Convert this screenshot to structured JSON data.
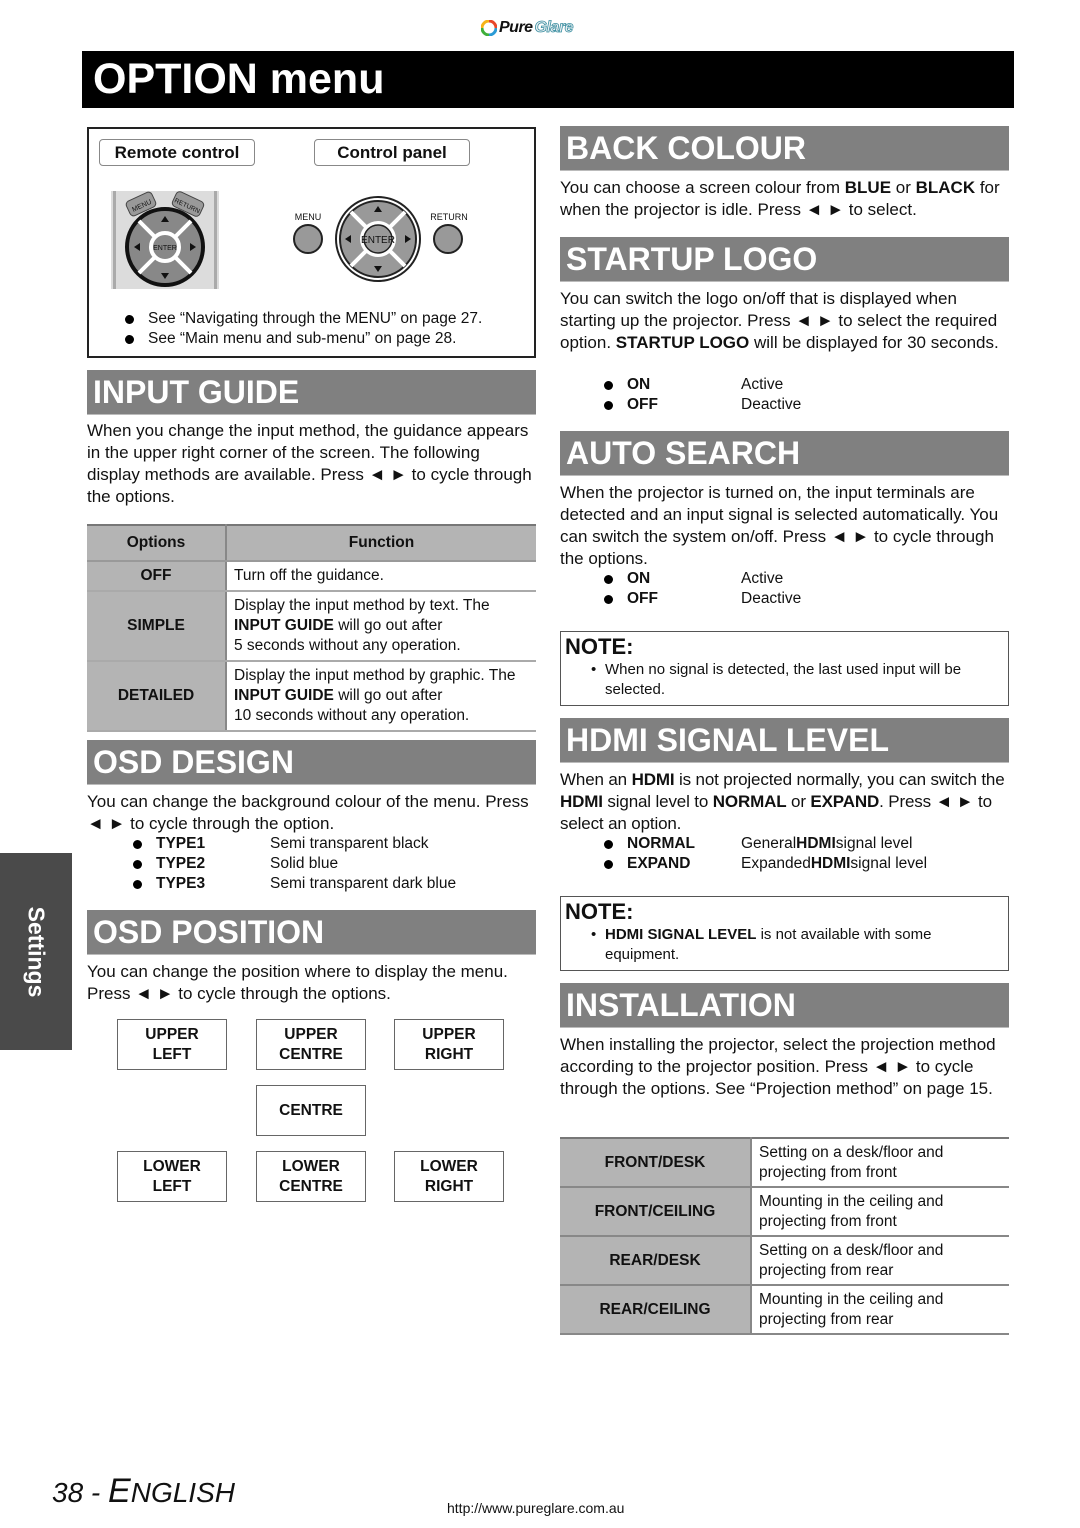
{
  "header": {
    "logo_part1": "Pure",
    "logo_part2": "Glare",
    "title": "OPTION menu"
  },
  "side_tab": {
    "label": "Settings"
  },
  "nav_box": {
    "remote_label": "Remote control",
    "panel_label": "Control panel",
    "remote_buttons": {
      "menu": "MENU",
      "return": "RETURN",
      "enter": "ENTER"
    },
    "panel_buttons": {
      "menu": "MENU",
      "return": "RETURN",
      "enter": "ENTER"
    },
    "bullets": [
      "See “Navigating through the MENU” on page 27.",
      "See “Main menu and sub-menu” on page 28."
    ]
  },
  "input_guide": {
    "heading": "INPUT GUIDE",
    "text": "When you change the input method, the guidance appears in the upper right corner of the screen. The following display methods are available. Press ◄ ► to cycle through the options.",
    "table": {
      "headers": [
        "Options",
        "Function"
      ],
      "rows": [
        {
          "option": "OFF",
          "line1": "Turn off the guidance.",
          "bold": "",
          "line2": "",
          "line3": ""
        },
        {
          "option": "SIMPLE",
          "line1": "Display the input method by text. The",
          "bold": "INPUT GUIDE",
          "line2": " will go out after",
          "line3": "5 seconds without any operation."
        },
        {
          "option": "DETAILED",
          "line1": "Display the input method by graphic. The",
          "bold": "INPUT GUIDE",
          "line2": " will go out after",
          "line3": "10 seconds without any operation."
        }
      ]
    }
  },
  "osd_design": {
    "heading": "OSD DESIGN",
    "text": "You can change the background colour of the menu. Press ◄ ► to cycle through the option.",
    "options": [
      {
        "key": "TYPE1",
        "value": "Semi transparent black"
      },
      {
        "key": "TYPE2",
        "value": "Solid blue"
      },
      {
        "key": "TYPE3",
        "value": "Semi transparent dark blue"
      }
    ]
  },
  "osd_position": {
    "heading": "OSD POSITION",
    "text": "You can change the position where to display the menu. Press ◄ ► to cycle through the options.",
    "positions": {
      "upper_left": [
        "UPPER",
        "LEFT"
      ],
      "upper_centre": [
        "UPPER",
        "CENTRE"
      ],
      "upper_right": [
        "UPPER",
        "RIGHT"
      ],
      "centre": [
        "CENTRE"
      ],
      "lower_left": [
        "LOWER",
        "LEFT"
      ],
      "lower_centre": [
        "LOWER",
        "CENTRE"
      ],
      "lower_right": [
        "LOWER",
        "RIGHT"
      ]
    }
  },
  "back_colour": {
    "heading": "BACK COLOUR",
    "t1": "You can choose a screen colour from ",
    "b1": "BLUE",
    "t2": " or ",
    "b2": "BLACK",
    "t3": " for when the projector is idle. Press ◄ ► to select."
  },
  "startup_logo": {
    "heading": "STARTUP LOGO",
    "t1": "You can switch the logo on/off that is displayed when starting up the projector. Press ◄ ► to select the required option. ",
    "b1": "STARTUP LOGO",
    "t2": " will be displayed for 30 seconds.",
    "options": [
      {
        "key": "ON",
        "value": "Active"
      },
      {
        "key": "OFF",
        "value": "Deactive"
      }
    ]
  },
  "auto_search": {
    "heading": "AUTO SEARCH",
    "text": "When the projector is turned on, the input terminals are detected and an input signal is selected automatically. You can switch the system on/off. Press ◄ ► to cycle through the options.",
    "options": [
      {
        "key": "ON",
        "value": "Active"
      },
      {
        "key": "OFF",
        "value": "Deactive"
      }
    ],
    "note": {
      "title": "NOTE:",
      "bullet": "•",
      "text": "When no signal is detected, the last used input will be selected."
    }
  },
  "hdmi_signal": {
    "heading": "HDMI SIGNAL LEVEL",
    "t1": "When an ",
    "b1": "HDMI",
    "t2": " is not projected normally, you can switch the ",
    "b2": "HDMI",
    "t3": " signal level to ",
    "b3": "NORMAL",
    "t4": " or ",
    "b4": "EXPAND",
    "t5": ". Press ◄ ► to select an option.",
    "options": [
      {
        "key": "NORMAL",
        "pre": "General ",
        "bold": "HDMI",
        "post": " signal level"
      },
      {
        "key": "EXPAND",
        "pre": "Expanded ",
        "bold": "HDMI",
        "post": " signal level"
      }
    ],
    "note": {
      "title": "NOTE:",
      "bullet": "•",
      "bold": "HDMI SIGNAL LEVEL",
      "text": " is not available with some equipment."
    }
  },
  "installation": {
    "heading": "INSTALLATION",
    "text": "When installing the projector, select the projection method according to the projector position. Press ◄ ► to cycle through the options. See “Projection method” on page 15.",
    "rows": [
      {
        "option": "FRONT/DESK",
        "l1": "Setting on a desk/floor and",
        "l2": "projecting from front"
      },
      {
        "option": "FRONT/CEILING",
        "l1": "Mounting in the ceiling and",
        "l2": "projecting from front"
      },
      {
        "option": "REAR/DESK",
        "l1": "Setting on a desk/floor and",
        "l2": "projecting from rear"
      },
      {
        "option": "REAR/CEILING",
        "l1": "Mounting in the ceiling and",
        "l2": "projecting from rear"
      }
    ]
  },
  "footer": {
    "page_number": "38 - ",
    "lang_initial": "E",
    "lang_rest": "NGLISH",
    "url": "http://www.pureglare.com.au"
  }
}
